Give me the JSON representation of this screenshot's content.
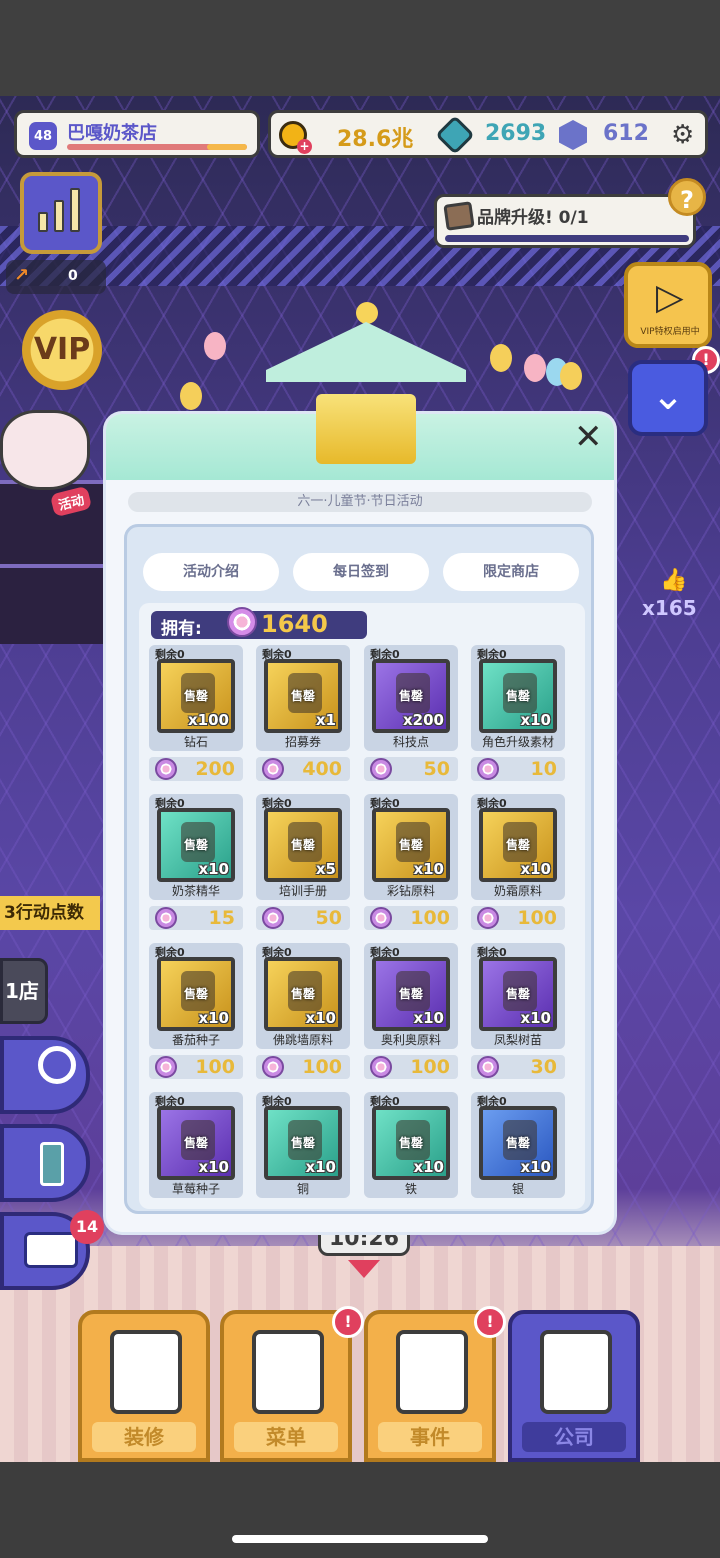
{
  "hud": {
    "level": "48",
    "shop_name": "巴嘎奶茶店",
    "coins": "28.6兆",
    "gems_teal": "2693",
    "gems_purple": "612",
    "trend_value": "0",
    "brand_upgrade": "品牌升级! 0/1",
    "vip_label": "VIP",
    "vip_play_label": "VIP特权启用中",
    "activity_tag": "活动",
    "action_points": "3行动点数",
    "store_label": "1店",
    "likes": "x165",
    "clock": "10:26",
    "notif_count": "14"
  },
  "nav": [
    {
      "label": "装修",
      "icon": "paint-roller-icon"
    },
    {
      "label": "菜单",
      "icon": "menu-doc-icon"
    },
    {
      "label": "事件",
      "icon": "calendar-icon"
    },
    {
      "label": "公司",
      "icon": "building-icon"
    }
  ],
  "modal": {
    "title": "六一·儿童节·节日活动",
    "tabs": [
      "活动介绍",
      "每日签到",
      "限定商店"
    ],
    "owned_label": "拥有:",
    "owned_value": "1640",
    "sold_label": "售罄",
    "items": [
      {
        "remain": "剩余0",
        "name": "钻石",
        "qty": "x100",
        "price": "200",
        "color": "gold"
      },
      {
        "remain": "剩余0",
        "name": "招募券",
        "qty": "x1",
        "price": "400",
        "color": "gold"
      },
      {
        "remain": "剩余0",
        "name": "科技点",
        "qty": "x200",
        "price": "50",
        "color": "purple"
      },
      {
        "remain": "剩余0",
        "name": "角色升级素材",
        "qty": "x10",
        "price": "10",
        "color": "teal"
      },
      {
        "remain": "剩余0",
        "name": "奶茶精华",
        "qty": "x10",
        "price": "15",
        "color": "teal"
      },
      {
        "remain": "剩余0",
        "name": "培训手册",
        "qty": "x5",
        "price": "50",
        "color": "gold"
      },
      {
        "remain": "剩余0",
        "name": "彩钻原料",
        "qty": "x10",
        "price": "100",
        "color": "gold"
      },
      {
        "remain": "剩余0",
        "name": "奶霜原料",
        "qty": "x10",
        "price": "100",
        "color": "gold"
      },
      {
        "remain": "剩余0",
        "name": "番茄种子",
        "qty": "x10",
        "price": "100",
        "color": "gold"
      },
      {
        "remain": "剩余0",
        "name": "佛跳墙原料",
        "qty": "x10",
        "price": "100",
        "color": "gold"
      },
      {
        "remain": "剩余0",
        "name": "奥利奥原料",
        "qty": "x10",
        "price": "100",
        "color": "purple"
      },
      {
        "remain": "剩余0",
        "name": "凤梨树苗",
        "qty": "x10",
        "price": "30",
        "color": "purple"
      },
      {
        "remain": "剩余0",
        "name": "草莓种子",
        "qty": "x10",
        "price": "",
        "color": "purple"
      },
      {
        "remain": "剩余0",
        "name": "铜",
        "qty": "x10",
        "price": "",
        "color": "teal"
      },
      {
        "remain": "剩余0",
        "name": "铁",
        "qty": "x10",
        "price": "",
        "color": "teal"
      },
      {
        "remain": "剩余0",
        "name": "银",
        "qty": "x10",
        "price": "",
        "color": "blue"
      }
    ]
  }
}
